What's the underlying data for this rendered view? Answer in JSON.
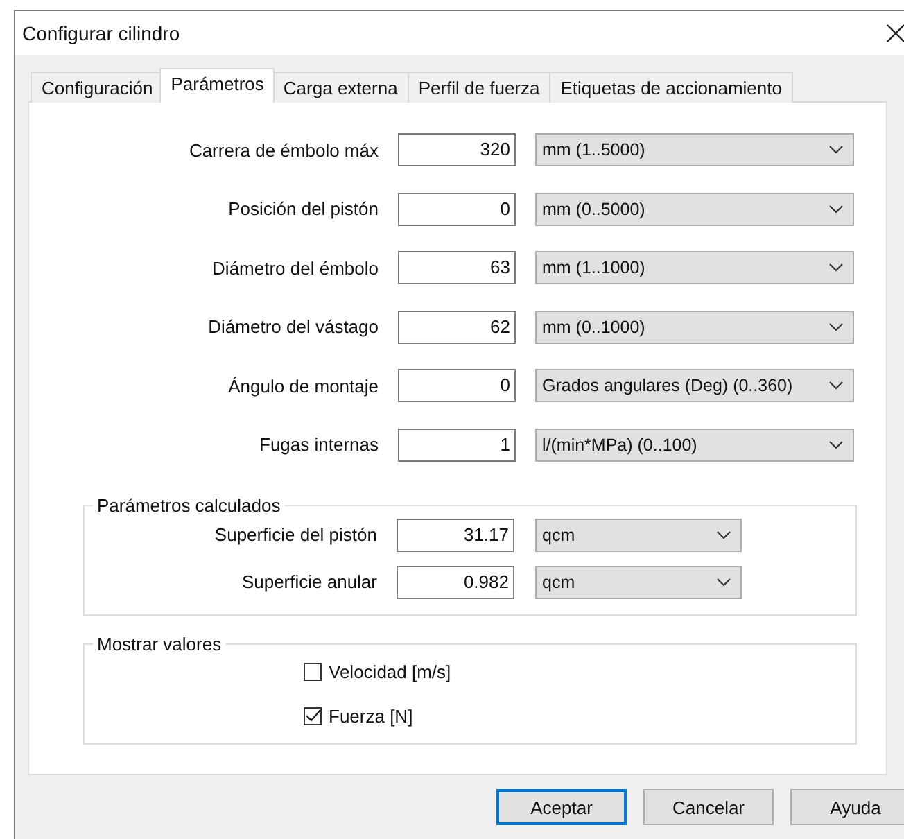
{
  "window": {
    "title": "Configurar cilindro"
  },
  "tabs": [
    {
      "label": "Configuración",
      "selected": false
    },
    {
      "label": "Parámetros",
      "selected": true
    },
    {
      "label": "Carga externa",
      "selected": false
    },
    {
      "label": "Perfil de fuerza",
      "selected": false
    },
    {
      "label": "Etiquetas de accionamiento",
      "selected": false
    }
  ],
  "parameters": [
    {
      "label": "Carrera de émbolo máx",
      "value": "320",
      "unit": "mm  (1..5000)"
    },
    {
      "label": "Posición del pistón",
      "value": "0",
      "unit": "mm  (0..5000)"
    },
    {
      "label": "Diámetro del émbolo",
      "value": "63",
      "unit": "mm  (1..1000)"
    },
    {
      "label": "Diámetro del vástago",
      "value": "62",
      "unit": "mm  (0..1000)"
    },
    {
      "label": "Ángulo de montaje",
      "value": "0",
      "unit": "Grados angulares (Deg)  (0..360)"
    },
    {
      "label": "Fugas internas",
      "value": "1",
      "unit": "l/(min*MPa)  (0..100)"
    }
  ],
  "calculated": {
    "title": "Parámetros calculados",
    "rows": [
      {
        "label": "Superficie del pistón",
        "value": "31.17",
        "unit": "qcm"
      },
      {
        "label": "Superficie anular",
        "value": "0.982",
        "unit": "qcm"
      }
    ]
  },
  "display": {
    "title": "Mostrar valores",
    "options": [
      {
        "label": "Velocidad [m/s]",
        "checked": false
      },
      {
        "label": "Fuerza [N]",
        "checked": true
      }
    ]
  },
  "buttons": [
    {
      "label": "Aceptar",
      "default": true
    },
    {
      "label": "Cancelar",
      "default": false
    },
    {
      "label": "Ayuda",
      "default": false
    }
  ]
}
